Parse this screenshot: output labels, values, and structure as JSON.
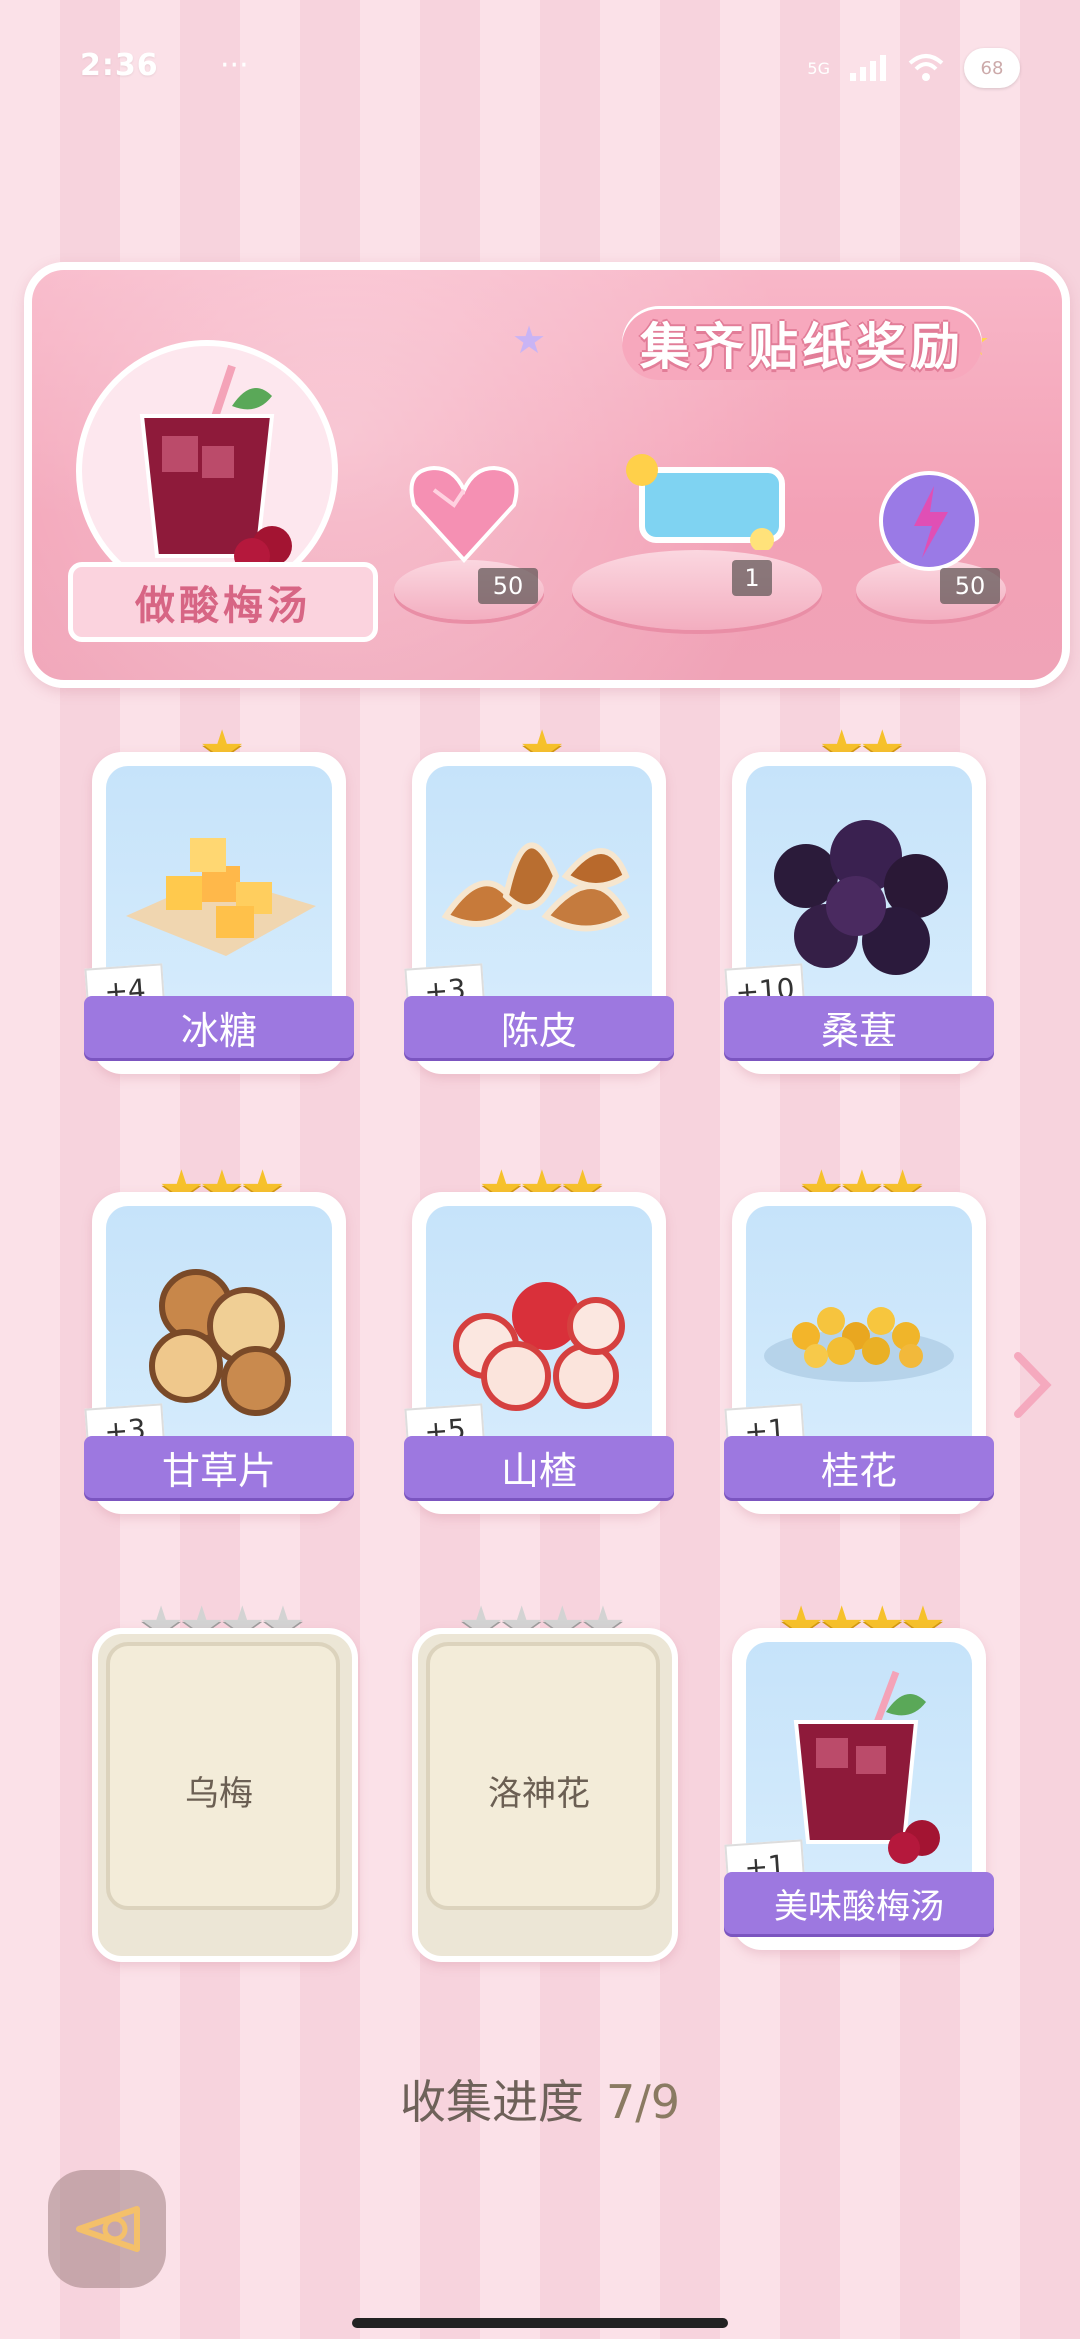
{
  "status_bar": {
    "time": "2:36",
    "more": "···",
    "network": "5G",
    "avatar_badge": "68",
    "icons": [
      "signal-icon",
      "wifi-icon",
      "avatar-icon"
    ]
  },
  "banner": {
    "title": "集齐贴纸奖励",
    "make_button_label": "做酸梅汤",
    "rewards": [
      {
        "name": "heart-gem-icon",
        "count": "50"
      },
      {
        "name": "drink-sticker-icon",
        "count": "1"
      },
      {
        "name": "energy-orb-icon",
        "count": "50"
      }
    ]
  },
  "cards": [
    {
      "name": "冰糖",
      "stars": "★",
      "bonus": "+4",
      "icon": "rock-sugar-icon"
    },
    {
      "name": "陈皮",
      "stars": "★",
      "bonus": "+3",
      "icon": "orange-peel-icon"
    },
    {
      "name": "桑葚",
      "stars": "★★",
      "bonus": "+10",
      "icon": "mulberry-icon"
    },
    {
      "name": "甘草片",
      "stars": "★★★",
      "bonus": "+3",
      "icon": "licorice-slices-icon"
    },
    {
      "name": "山楂",
      "stars": "★★★",
      "bonus": "+5",
      "icon": "hawthorn-icon"
    },
    {
      "name": "桂花",
      "stars": "★★★",
      "bonus": "+1",
      "icon": "osmanthus-icon"
    },
    {
      "name": "乌梅",
      "stars": "★★★★",
      "locked": true
    },
    {
      "name": "洛神花",
      "stars": "★★★★",
      "locked": true
    },
    {
      "name": "美味酸梅汤",
      "stars": "★★★★",
      "bonus": "+1",
      "icon": "plum-drink-icon"
    }
  ],
  "progress": {
    "label": "收集进度",
    "value": "7/9"
  },
  "colors": {
    "accent_purple": "#9d78e0",
    "banner_pink": "#f3a1b6",
    "star_gold": "#f6c12b"
  }
}
